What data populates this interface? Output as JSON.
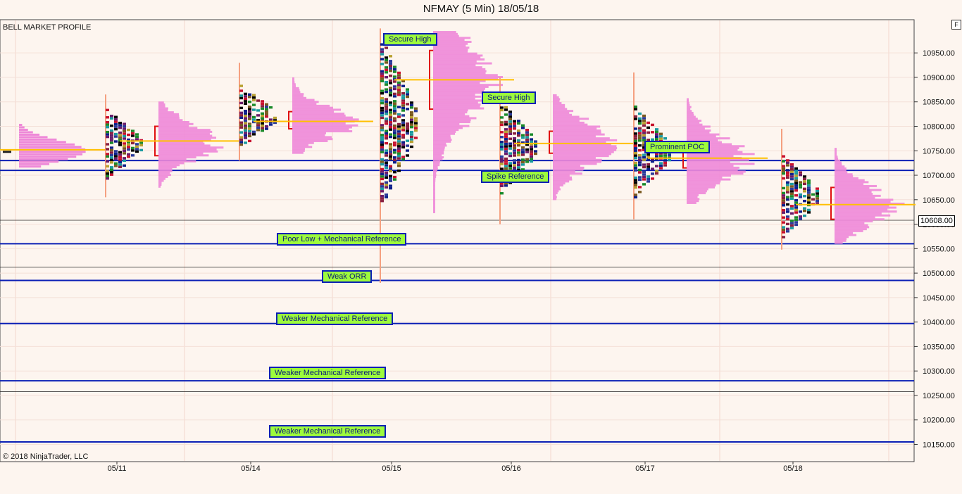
{
  "window": {
    "title": "NFMAY (5 Min)  18/05/18",
    "corner_button": "F"
  },
  "chart_labels": {
    "profile_name": "BELL MARKET PROFILE",
    "copyright": "© 2018 NinjaTrader, LLC",
    "last_price": "10608.00"
  },
  "colors": {
    "reference_line": "#0a1fb5",
    "poc_line": "#ffc000",
    "annotation_bg": "#9dfb3c",
    "profile": "#ee88d8",
    "value_area_bracket": "#e01010",
    "background": "#fdf5ef"
  },
  "chart_data": {
    "type": "market-profile",
    "y_axis": {
      "range": [
        10130,
        11000
      ],
      "ticks": [
        10150,
        10200,
        10250,
        10300,
        10350,
        10400,
        10450,
        10500,
        10550,
        10600,
        10650,
        10700,
        10750,
        10800,
        10850,
        10900,
        10950
      ]
    },
    "x_axis": {
      "labels": [
        "05/11",
        "05/14",
        "05/15",
        "05/16",
        "05/17",
        "05/18"
      ]
    },
    "reference_lines": [
      {
        "name": "upper-band",
        "price": 10730
      },
      {
        "name": "lower-band",
        "price": 10710
      },
      {
        "name": "poor-low",
        "price": 10560
      },
      {
        "name": "weak-orr",
        "price": 10485
      },
      {
        "name": "weaker-1",
        "price": 10397
      },
      {
        "name": "weaker-2",
        "price": 10280
      },
      {
        "name": "weaker-3",
        "price": 10155
      }
    ],
    "thin_lines": [
      10608,
      10512,
      10258
    ],
    "annotations": [
      {
        "text": "Secure High",
        "price": 10987
      },
      {
        "text": "Secure High",
        "price": 10868
      },
      {
        "text": "Prominent POC",
        "price": 10762
      },
      {
        "text": "Spike Reference",
        "price": 10706
      },
      {
        "text": "Poor Low + Mechanical Reference",
        "price": 10581
      },
      {
        "text": "Weak ORR",
        "price": 10505
      },
      {
        "text": "Weaker Mechanical Reference",
        "price": 10419
      },
      {
        "text": "Weaker Mechanical Reference",
        "price": 10308
      },
      {
        "text": "Weaker Mechanical Reference",
        "price": 10189
      }
    ],
    "sessions": [
      {
        "date": "05/11",
        "high": 10865,
        "low": 10655,
        "poc": 10770,
        "va_high": 10800,
        "va_low": 10740
      },
      {
        "date": "05/14",
        "high": 10930,
        "low": 10730,
        "poc": 10810,
        "va_high": 10830,
        "va_low": 10795
      },
      {
        "date": "05/15",
        "high": 11000,
        "low": 10480,
        "poc": 10895,
        "va_high": 10955,
        "va_low": 10835
      },
      {
        "date": "05/16",
        "high": 10900,
        "low": 10600,
        "poc": 10765,
        "va_high": 10790,
        "va_low": 10745
      },
      {
        "date": "05/17",
        "high": 10910,
        "low": 10610,
        "poc": 10735,
        "va_high": 10760,
        "va_low": 10715
      },
      {
        "date": "05/18",
        "high": 10795,
        "low": 10548,
        "poc": 10640,
        "va_high": 10675,
        "va_low": 10610
      }
    ]
  }
}
